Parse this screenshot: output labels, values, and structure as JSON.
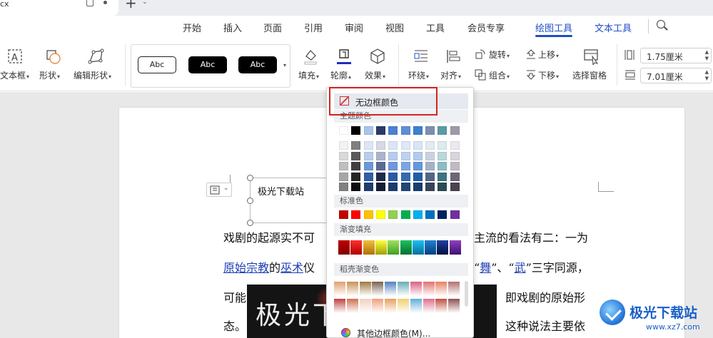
{
  "title_bar": {
    "doc_tab_name": "cx"
  },
  "menu": {
    "tabs": [
      "开始",
      "插入",
      "页面",
      "引用",
      "审阅",
      "视图",
      "工具",
      "会员专享",
      "绘图工具",
      "文本工具"
    ],
    "active_tab": "绘图工具"
  },
  "ribbon": {
    "text_box": "文本框",
    "shape": "形状",
    "edit_shape": "编辑形状",
    "style_samples": [
      "Abc",
      "Abc",
      "Abc"
    ],
    "fill": "填充",
    "outline": "轮廓",
    "effect": "效果",
    "wrap": "环绕",
    "align": "对齐",
    "rotate": "旋转",
    "group": "组合",
    "bring_forward": "上移",
    "send_backward": "下移",
    "selection_pane": "选择窗格",
    "height_value": "1.75厘米",
    "width_value": "7.01厘米"
  },
  "document": {
    "textbox_text": "极光下载站",
    "line1_left": "戏剧的起源实不可",
    "line1_right": "主流的看法有二：一为",
    "line2_link1": "原始宗教",
    "line2_mid": "的",
    "line2_link2": "巫术",
    "line2_after": "仪",
    "line2_right_q1": "“",
    "line2_right_link3": "舞",
    "line2_right_mid": "”、“",
    "line2_right_link4": "武",
    "line2_right_end": "”三字同源，",
    "line3_left": "可能",
    "line3_right": "即戏剧的原始形",
    "line4_left": "态。",
    "line4_right": "这种说法主要依",
    "banner_text": "极光下"
  },
  "outline_dropdown": {
    "no_border": "无边框颜色",
    "theme_colors_label": "主题颜色",
    "standard_colors_label": "标准色",
    "gradient_fill_label": "渐变填充",
    "shell_gradient_label": "稻壳渐变色",
    "more_border_colors": "其他边框颜色(M)...",
    "theme_top_row": [
      "#ffffff",
      "#000000",
      "#a7c4ec",
      "#2b3a67",
      "#4a7fd4",
      "#5b8fd6",
      "#3d7fd0",
      "#7d8fb0",
      "#5a9aa8",
      "#a09aa8"
    ],
    "theme_columns": [
      [
        "#f2f2f2",
        "#d9d9d9",
        "#bfbfbf",
        "#a6a6a6",
        "#808080"
      ],
      [
        "#7f7f7f",
        "#595959",
        "#404040",
        "#262626",
        "#0d0d0d"
      ],
      [
        "#dce6f6",
        "#b8cdee",
        "#6b98dc",
        "#2f5fa8",
        "#1f3f70"
      ],
      [
        "#d5d9e5",
        "#acb4cb",
        "#5b6a97",
        "#202b4c",
        "#151d33"
      ],
      [
        "#dbe5f7",
        "#b7cbef",
        "#7096df",
        "#2a5aa6",
        "#1c3c6e"
      ],
      [
        "#dee8f7",
        "#bdd2ef",
        "#7ca5e0",
        "#346ab0",
        "#234775"
      ],
      [
        "#d8e5f6",
        "#b1cbed",
        "#6497dc",
        "#225ea5",
        "#173f6e"
      ],
      [
        "#e5e9f0",
        "#cbd2df",
        "#a6b1c8",
        "#556584",
        "#394358"
      ],
      [
        "#dcebed",
        "#b9d7dc",
        "#8bbcc4",
        "#3c7480",
        "#284d55"
      ],
      [
        "#eceaee",
        "#d9d5dc",
        "#c0bac5",
        "#6e6578",
        "#4a4350"
      ]
    ],
    "standard_colors": [
      "#c00000",
      "#ff0000",
      "#ffc000",
      "#ffff00",
      "#92d050",
      "#00b050",
      "#00b0f0",
      "#0070c0",
      "#002060",
      "#7030a0"
    ],
    "gradient_colors": [
      [
        "#c00000",
        "#800000"
      ],
      [
        "#ff3030",
        "#b00000"
      ],
      [
        "#f0c040",
        "#b07000"
      ],
      [
        "#ffff40",
        "#a0a000"
      ],
      [
        "#a0e060",
        "#40a020"
      ],
      [
        "#20c060",
        "#007030"
      ],
      [
        "#20c0f0",
        "#0070a0"
      ],
      [
        "#2080d0",
        "#004080"
      ],
      [
        "#2040a0",
        "#001040"
      ],
      [
        "#9040c0",
        "#401070"
      ]
    ],
    "shell_gradient_rows": [
      [
        "#e0a070",
        "#c89058",
        "#a07840",
        "#7a6050",
        "#5080c0",
        "#6aaab8",
        "#d86080",
        "#e07070",
        "#e88060",
        "#b07070"
      ],
      [
        "#c04040",
        "#d07050",
        "#f0d0c0",
        "#f0a080",
        "#e8a060",
        "#f0d070",
        "#60b0d8",
        "#e07090",
        "#c05040",
        "#905050"
      ]
    ]
  },
  "watermark": {
    "title": "极光下载站",
    "url": "www.xz7.com"
  }
}
